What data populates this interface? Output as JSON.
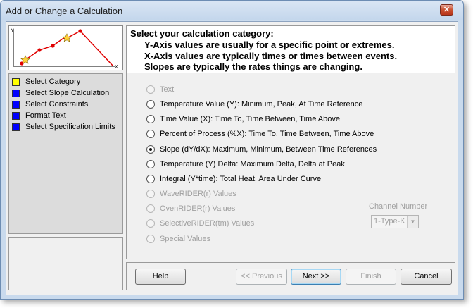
{
  "window": {
    "title": "Add or Change a Calculation",
    "close_symbol": "✕"
  },
  "thumbnail": {
    "y_label": "Y",
    "x_label": "X"
  },
  "steps": [
    {
      "label": "Select Category",
      "color": "#ffff00"
    },
    {
      "label": "Select Slope Calculation",
      "color": "#0000ff"
    },
    {
      "label": "Select Constraints",
      "color": "#0000ff"
    },
    {
      "label": "Format Text",
      "color": "#0000ff"
    },
    {
      "label": "Select Specification Limits",
      "color": "#0000ff"
    }
  ],
  "header": {
    "line1": "Select your calculation category:",
    "line2": "Y-Axis values are usually for a specific point or extremes.",
    "line3": "X-Axis values are typically times or times between events.",
    "line4": "Slopes are typically the rates things are changing."
  },
  "options": [
    {
      "label": "Text",
      "enabled": false,
      "checked": false
    },
    {
      "label": "Temperature Value (Y):  Minimum, Peak, At Time Reference",
      "enabled": true,
      "checked": false
    },
    {
      "label": "Time Value (X):  Time To, Time Between, Time Above",
      "enabled": true,
      "checked": false
    },
    {
      "label": "Percent of Process (%X):  Time To, Time Between, Time Above",
      "enabled": true,
      "checked": false
    },
    {
      "label": "Slope (dY/dX):  Maximum, Minimum, Between Time References",
      "enabled": true,
      "checked": true
    },
    {
      "label": "Temperature (Y) Delta:  Maximum Delta, Delta at Peak",
      "enabled": true,
      "checked": false
    },
    {
      "label": "Integral (Y*time): Total Heat, Area Under Curve",
      "enabled": true,
      "checked": false
    },
    {
      "label": "WaveRIDER(r) Values",
      "enabled": false,
      "checked": false
    },
    {
      "label": "OvenRIDER(r) Values",
      "enabled": false,
      "checked": false
    },
    {
      "label": "SelectiveRIDER(tm) Values",
      "enabled": false,
      "checked": false
    },
    {
      "label": "Special  Values",
      "enabled": false,
      "checked": false
    }
  ],
  "channel": {
    "label": "Channel Number",
    "value": "1-Type-K",
    "arrow": "▼"
  },
  "buttons": {
    "help": "Help",
    "previous": "<< Previous",
    "next": "Next >>",
    "finish": "Finish",
    "cancel": "Cancel"
  }
}
